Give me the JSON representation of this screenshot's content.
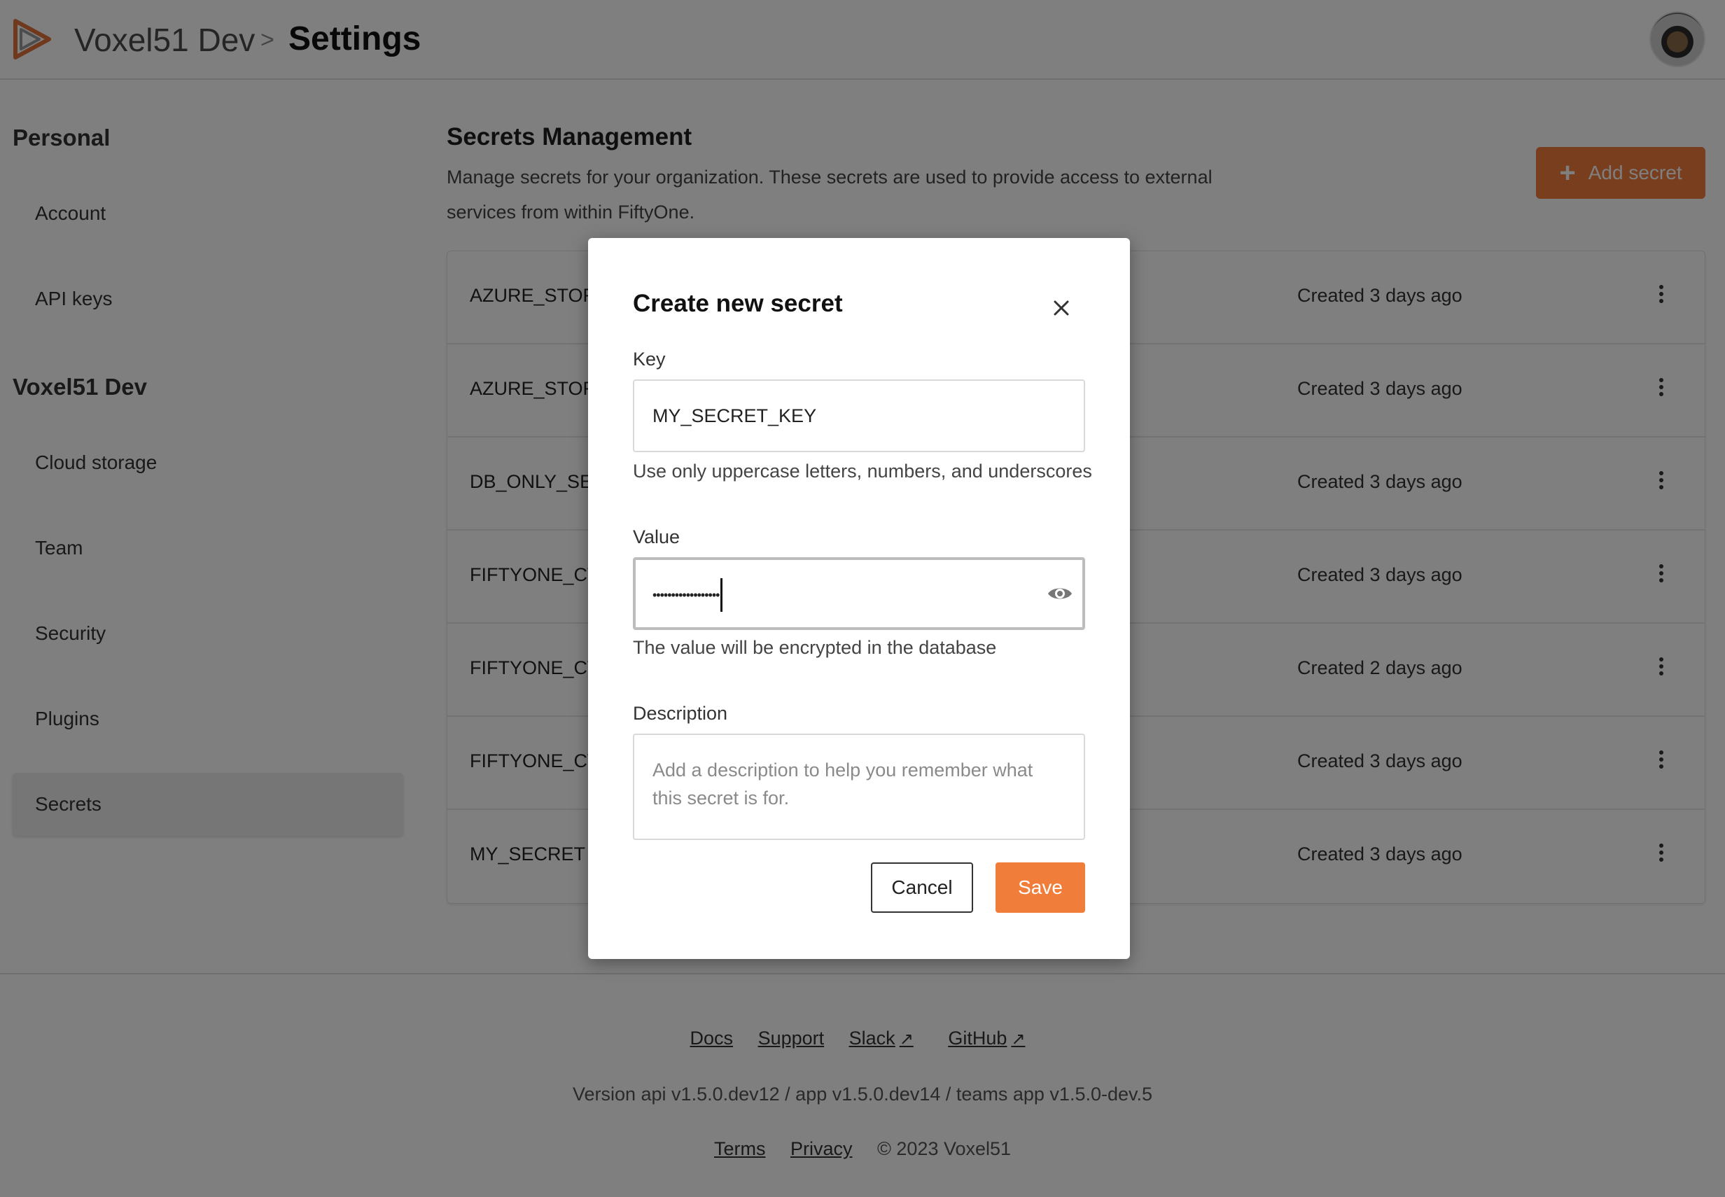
{
  "header": {
    "org": "Voxel51 Dev",
    "separator": ">",
    "page": "Settings",
    "logo_icon": "fiftyone-logo-icon",
    "avatar_icon": "user-avatar"
  },
  "sidebar": {
    "personal_heading": "Personal",
    "personal_items": [
      {
        "label": "Account"
      },
      {
        "label": "API keys"
      }
    ],
    "org_heading": "Voxel51 Dev",
    "org_items": [
      {
        "label": "Cloud storage"
      },
      {
        "label": "Team"
      },
      {
        "label": "Security"
      },
      {
        "label": "Plugins"
      },
      {
        "label": "Secrets",
        "active": true
      }
    ]
  },
  "main": {
    "title": "Secrets Management",
    "description": "Manage secrets for your organization. These secrets are used to provide access to external services from within FiftyOne.",
    "add_button": "Add secret",
    "secrets": [
      {
        "name": "AZURE_STORA",
        "created": "Created 3 days ago"
      },
      {
        "name": "AZURE_STORA",
        "created": "Created 3 days ago"
      },
      {
        "name": "DB_ONLY_SEC",
        "created": "Created 3 days ago"
      },
      {
        "name": "FIFTYONE_CVA",
        "created": "Created 3 days ago"
      },
      {
        "name": "FIFTYONE_CVA",
        "created": "Created 2 days ago"
      },
      {
        "name": "FIFTYONE_CVA",
        "created": "Created 3 days ago"
      },
      {
        "name": "MY_SECRET",
        "created": "Created 3 days ago"
      }
    ]
  },
  "modal": {
    "title": "Create new secret",
    "key_label": "Key",
    "key_value": "MY_SECRET_KEY",
    "key_helper": "Use only uppercase letters, numbers, and underscores",
    "value_label": "Value",
    "value_masked": "••••••••••••••••••",
    "value_helper": "The value will be encrypted in the database",
    "description_label": "Description",
    "description_placeholder": "Add a description to help you remember what this secret is for.",
    "cancel_label": "Cancel",
    "save_label": "Save"
  },
  "footer": {
    "links": [
      "Docs",
      "Support",
      "Slack",
      "GitHub"
    ],
    "version": "Version api v1.5.0.dev12 / app v1.5.0.dev14 / teams app v1.5.0-dev.5",
    "terms": "Terms",
    "privacy": "Privacy",
    "copyright": "© 2023 Voxel51"
  },
  "colors": {
    "accent": "#f07d3a",
    "overlay": "rgba(0,0,0,0.5)"
  }
}
